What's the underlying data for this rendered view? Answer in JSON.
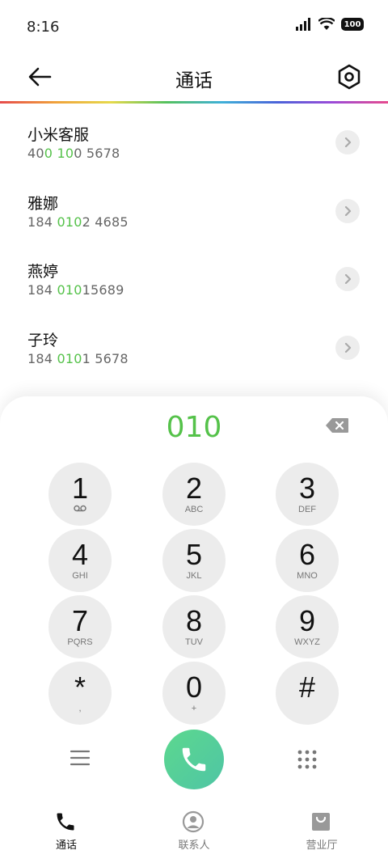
{
  "status": {
    "time": "8:16",
    "battery": "100"
  },
  "header": {
    "title": "通话"
  },
  "contacts": [
    {
      "name": "小米客服",
      "num_parts": [
        "40",
        "0",
        " ",
        "10",
        "0 5678"
      ]
    },
    {
      "name": "雅娜",
      "num_parts": [
        "184 ",
        "010",
        "2 4685"
      ]
    },
    {
      "name": "燕婷",
      "num_parts": [
        "184 ",
        "010",
        "15689"
      ]
    },
    {
      "name": "子玲",
      "num_parts": [
        "184 ",
        "010",
        "1 5678"
      ]
    }
  ],
  "dialpad": {
    "entered": "010",
    "keys": [
      {
        "digit": "1",
        "letters": ""
      },
      {
        "digit": "2",
        "letters": "ABC"
      },
      {
        "digit": "3",
        "letters": "DEF"
      },
      {
        "digit": "4",
        "letters": "GHI"
      },
      {
        "digit": "5",
        "letters": "JKL"
      },
      {
        "digit": "6",
        "letters": "MNO"
      },
      {
        "digit": "7",
        "letters": "PQRS"
      },
      {
        "digit": "8",
        "letters": "TUV"
      },
      {
        "digit": "9",
        "letters": "WXYZ"
      },
      {
        "digit": "*",
        "letters": ","
      },
      {
        "digit": "0",
        "letters": "+"
      },
      {
        "digit": "#",
        "letters": ""
      }
    ]
  },
  "tabs": [
    {
      "label": "通话",
      "icon": "phone-icon",
      "active": true
    },
    {
      "label": "联系人",
      "icon": "person-icon",
      "active": false
    },
    {
      "label": "营业厅",
      "icon": "bag-icon",
      "active": false
    }
  ],
  "colors": {
    "accent": "#55c24a",
    "call": "#55cf95"
  }
}
